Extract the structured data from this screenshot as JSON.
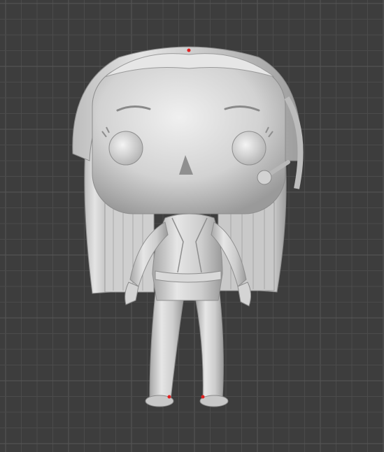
{
  "viewport": {
    "background": "#3d3d3d",
    "grid_minor_color": "#4b4b4b",
    "grid_major_color": "#575757"
  },
  "model": {
    "description_icon": "funko-figure-model",
    "body_color": "#cfcfcf",
    "shadow_color": "#8e8e8e",
    "highlight_color": "#f2f2f2",
    "seam_marker_color": "#e02020"
  }
}
